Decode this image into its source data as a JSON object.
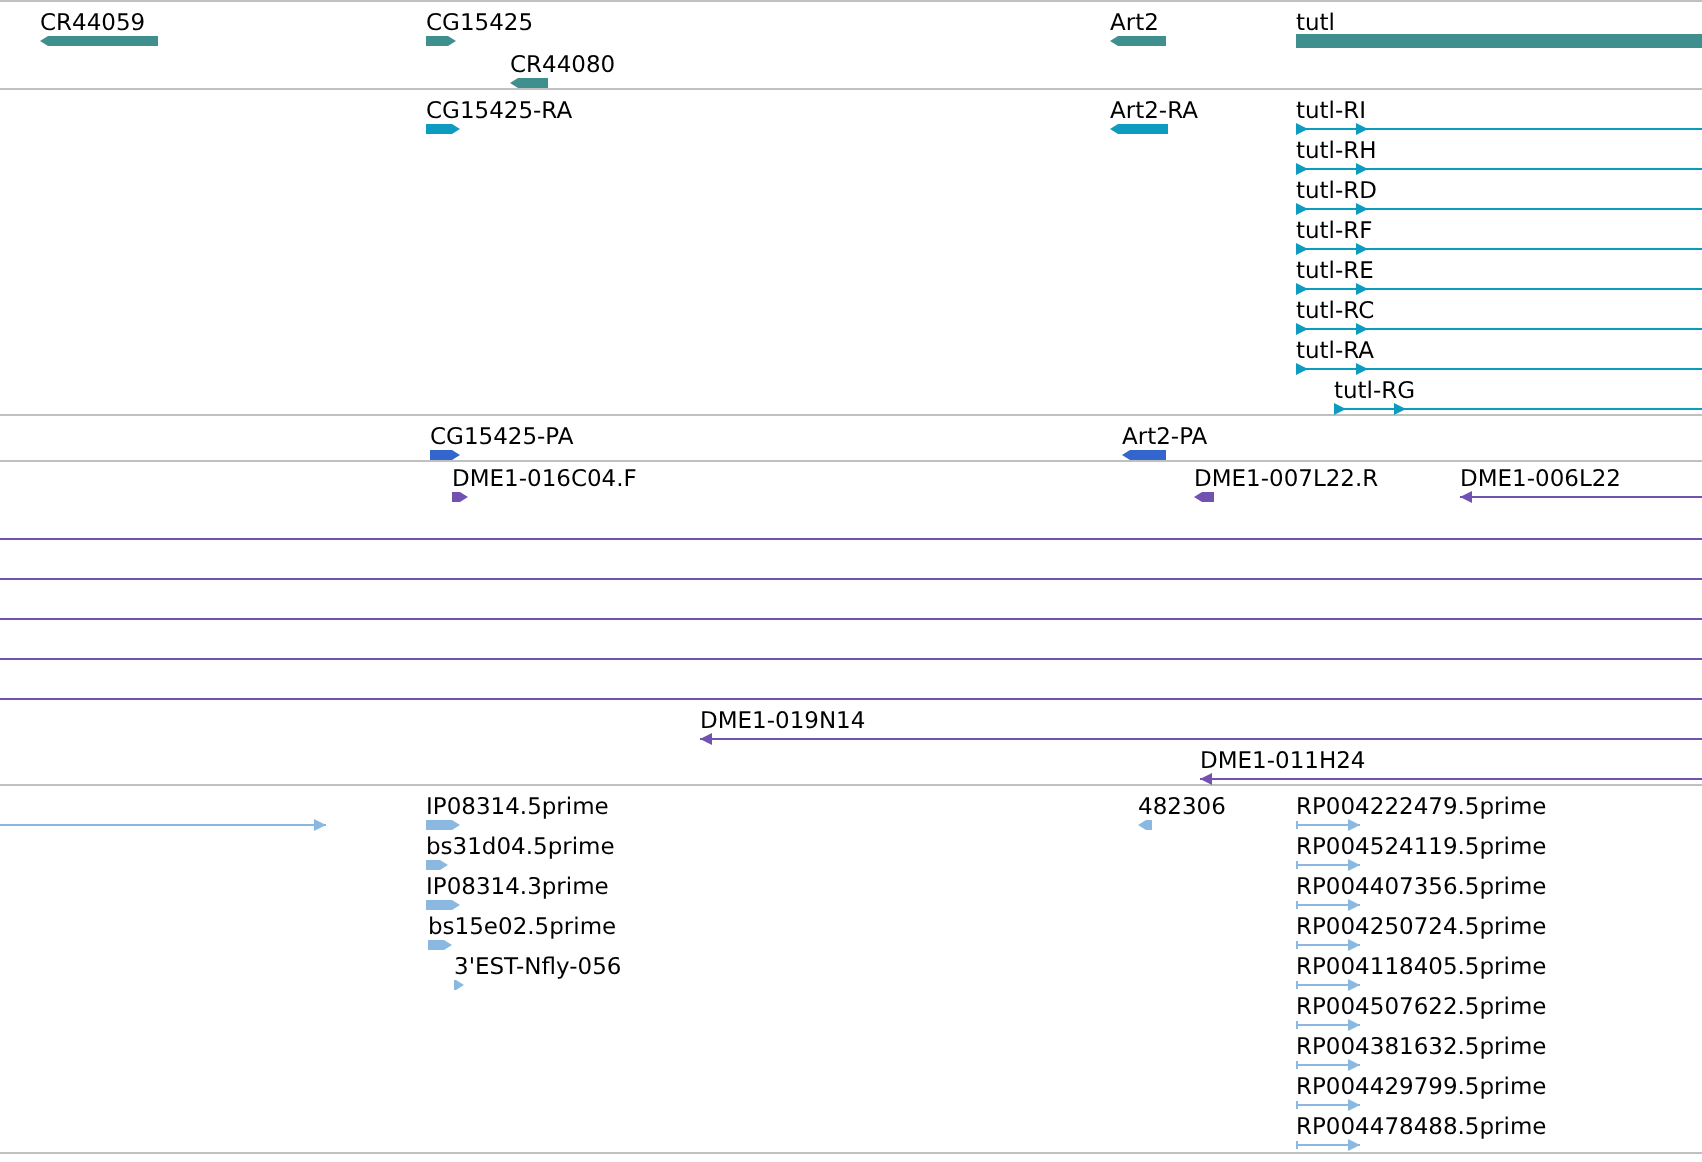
{
  "tracks": [
    {
      "color": "#3f8f8f",
      "features": [
        {
          "label": "CR44059",
          "kind": "reverse-block"
        },
        {
          "label": "CG15425",
          "kind": "forward-block"
        },
        {
          "label": "CR44080",
          "kind": "reverse-block"
        },
        {
          "label": "Art2",
          "kind": "reverse-block"
        },
        {
          "label": "tutl",
          "kind": "plain-block"
        }
      ]
    },
    {
      "color": "#0e9bc0",
      "features": [
        {
          "label": "CG15425-RA",
          "kind": "forward-block"
        },
        {
          "label": "Art2-RA",
          "kind": "reverse-block"
        },
        {
          "label": "tutl-RI",
          "kind": "forward-line"
        },
        {
          "label": "tutl-RH",
          "kind": "forward-line"
        },
        {
          "label": "tutl-RD",
          "kind": "forward-line"
        },
        {
          "label": "tutl-RF",
          "kind": "forward-line"
        },
        {
          "label": "tutl-RE",
          "kind": "forward-line"
        },
        {
          "label": "tutl-RC",
          "kind": "forward-line"
        },
        {
          "label": "tutl-RA",
          "kind": "forward-line"
        },
        {
          "label": "tutl-RG",
          "kind": "forward-line"
        }
      ]
    },
    {
      "color": "#3366cc",
      "features": [
        {
          "label": "CG15425-PA",
          "kind": "forward-block"
        },
        {
          "label": "Art2-PA",
          "kind": "reverse-block"
        }
      ]
    },
    {
      "color": "#7252b0",
      "features": [
        {
          "label": "DME1-016C04.F",
          "kind": "forward-block"
        },
        {
          "label": "DME1-007L22.R",
          "kind": "reverse-block"
        },
        {
          "label": "DME1-006L22",
          "kind": "reverse-line"
        },
        {
          "kind": "plain-line"
        },
        {
          "kind": "plain-line"
        },
        {
          "kind": "plain-line"
        },
        {
          "kind": "plain-line"
        },
        {
          "kind": "plain-line"
        },
        {
          "label": "DME1-019N14",
          "kind": "reverse-line"
        },
        {
          "label": "DME1-011H24",
          "kind": "reverse-line"
        }
      ]
    },
    {
      "color": "#8ab8e0",
      "features": [
        {
          "kind": "forward-line"
        },
        {
          "label": "IP08314.5prime",
          "kind": "forward-block"
        },
        {
          "label": "bs31d04.5prime",
          "kind": "forward-block"
        },
        {
          "label": "IP08314.3prime",
          "kind": "forward-block"
        },
        {
          "label": "bs15e02.5prime",
          "kind": "forward-block"
        },
        {
          "label": "3'EST-Nfly-056",
          "kind": "forward-block"
        },
        {
          "label": "482306",
          "kind": "reverse-block"
        },
        {
          "label": "RP004222479.5prime",
          "kind": "forward-line"
        },
        {
          "label": "RP004524119.5prime",
          "kind": "forward-line"
        },
        {
          "label": "RP004407356.5prime",
          "kind": "forward-line"
        },
        {
          "label": "RP004250724.5prime",
          "kind": "forward-line"
        },
        {
          "label": "RP004118405.5prime",
          "kind": "forward-line"
        },
        {
          "label": "RP004507622.5prime",
          "kind": "forward-line"
        },
        {
          "label": "RP004381632.5prime",
          "kind": "forward-line"
        },
        {
          "label": "RP004429799.5prime",
          "kind": "forward-line"
        },
        {
          "label": "RP004478488.5prime",
          "kind": "forward-line"
        }
      ]
    }
  ]
}
